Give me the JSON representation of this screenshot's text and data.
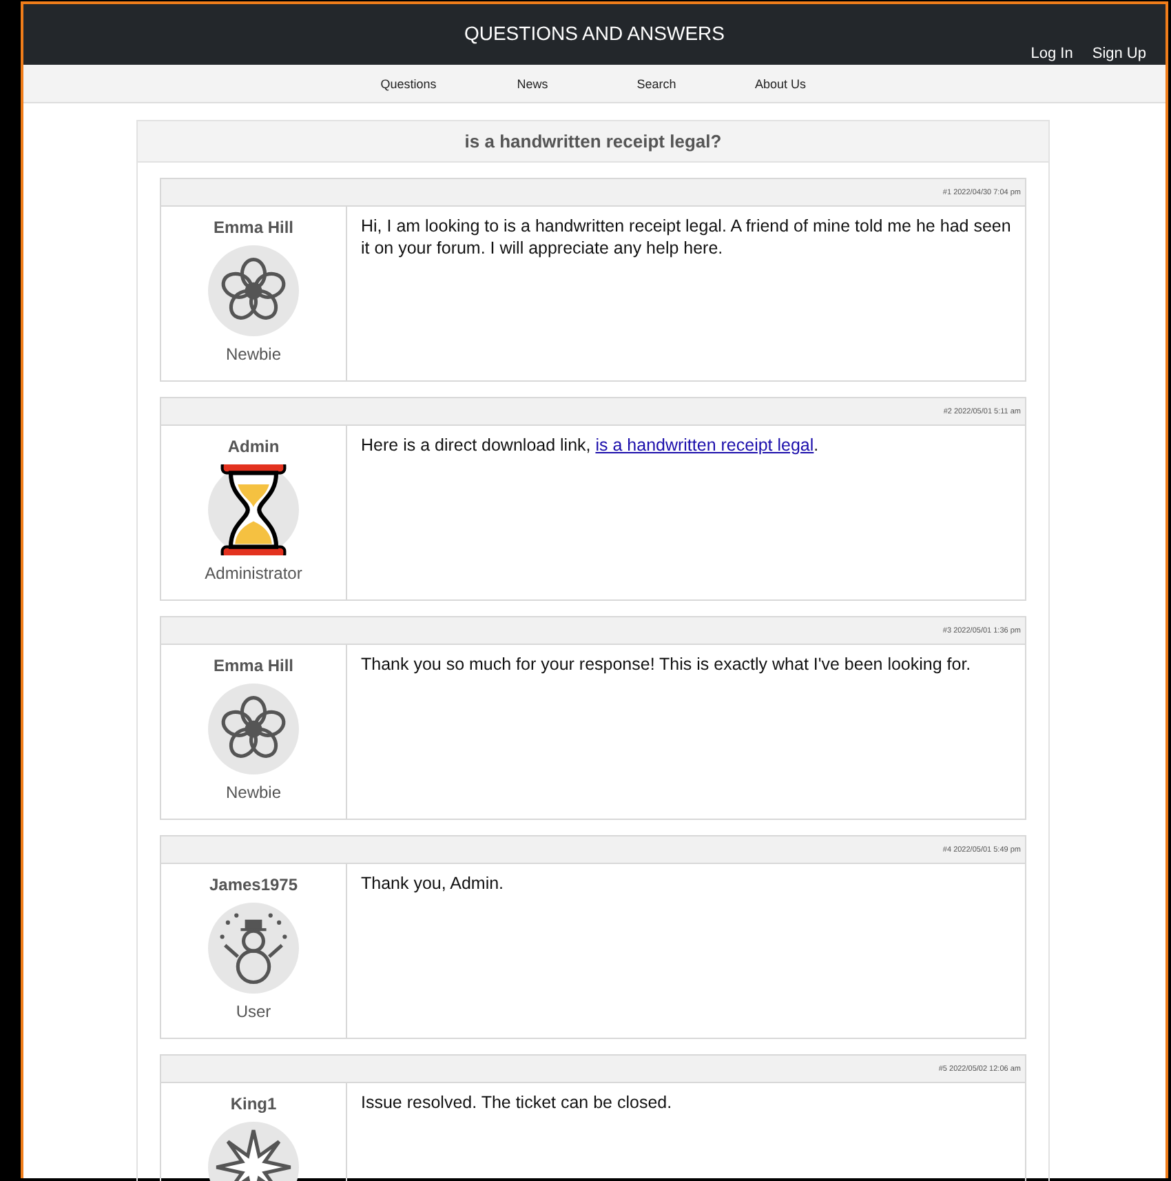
{
  "header": {
    "title": "QUESTIONS AND ANSWERS",
    "auth_links": [
      "Log In",
      "Sign Up"
    ]
  },
  "nav": [
    "Questions",
    "News",
    "Search",
    "About Us"
  ],
  "topic": {
    "title": "is a handwritten receipt legal?"
  },
  "posts": [
    {
      "meta": "#1 2022/04/30 7:04 pm",
      "author": "Emma Hill",
      "avatar": {
        "kind": "flower"
      },
      "role": "Newbie",
      "message": "Hi, I am looking to is a handwritten receipt legal. A friend of mine told me he had seen it on your forum. I will appreciate any help here."
    },
    {
      "meta": "#2 2022/05/01 5:11 am",
      "author": "Admin",
      "avatar": {
        "kind": "hourglass"
      },
      "role": "Administrator",
      "message": "Here is a direct download link, ",
      "link": "is a handwritten receipt legal",
      "message_end": "."
    },
    {
      "meta": "#3 2022/05/01 1:36 pm",
      "author": "Emma Hill",
      "avatar": {
        "kind": "flower"
      },
      "role": "Newbie",
      "message": "Thank you so much for your response! This is exactly what I've been looking for."
    },
    {
      "meta": "#4 2022/05/01 5:49 pm",
      "author": "James1975",
      "avatar": {
        "kind": "snowman"
      },
      "role": "User",
      "message": "Thank you, Admin."
    },
    {
      "meta": "#5 2022/05/02 12:06 am",
      "author": "King1",
      "avatar": {
        "kind": "star"
      },
      "message": "Issue resolved. The ticket can be closed."
    }
  ]
}
